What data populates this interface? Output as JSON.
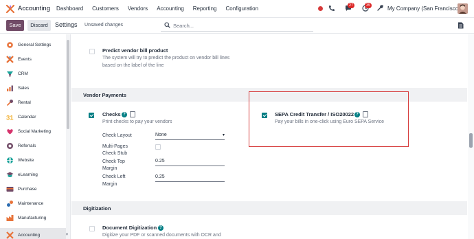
{
  "navbar": {
    "app_name": "Accounting",
    "menu": [
      "Dashboard",
      "Customers",
      "Vendors",
      "Accounting",
      "Reporting",
      "Configuration"
    ],
    "chat_badge": "27",
    "activity_badge": "35",
    "company": "My Company (San Francisco)"
  },
  "control": {
    "save_label": "Save",
    "discard_label": "Discard",
    "breadcrumb": "Settings",
    "status": "Unsaved changes",
    "search_placeholder": "Search..."
  },
  "sidebar": {
    "items": [
      {
        "label": "General Settings",
        "color": "#e8743b"
      },
      {
        "label": "Events",
        "color": "#e8743b"
      },
      {
        "label": "CRM",
        "color": "#1aa39a"
      },
      {
        "label": "Sales",
        "color": "#e8743b"
      },
      {
        "label": "Rental",
        "color": "#714b67"
      },
      {
        "label": "Calendar",
        "color": "#f2b134"
      },
      {
        "label": "Social Marketing",
        "color": "#d6336c"
      },
      {
        "label": "Referrals",
        "color": "#714b67"
      },
      {
        "label": "Website",
        "color": "#1aa39a"
      },
      {
        "label": "eLearning",
        "color": "#714b67"
      },
      {
        "label": "Purchase",
        "color": "#714b67"
      },
      {
        "label": "Maintenance",
        "color": "#2b6cb0"
      },
      {
        "label": "Manufacturing",
        "color": "#e8743b"
      },
      {
        "label": "Accounting",
        "color": "#e8743b"
      }
    ]
  },
  "settings": {
    "predict": {
      "title": "Predict vendor bill product",
      "desc_line1": "The system will try to predict the product on vendor bill lines",
      "desc_line2": "based on the label of the line"
    },
    "vendor_payments": {
      "heading": "Vendor Payments",
      "checks": {
        "title": "Checks",
        "desc": "Print checks to pay your vendors",
        "check_layout_label": "Check Layout",
        "check_layout_value": "None",
        "multi_pages_label_1": "Multi-Pages",
        "multi_pages_label_2": "Check Stub",
        "check_top_label_1": "Check Top",
        "check_top_label_2": "Margin",
        "check_top_value": "0.25",
        "check_left_label_1": "Check Left",
        "check_left_label_2": "Margin",
        "check_left_value": "0.25"
      },
      "sepa": {
        "title": "SEPA Credit Transfer / ISO20022",
        "desc": "Pay your bills in one-click using Euro SEPA Service"
      }
    },
    "digitization": {
      "heading": "Digitization",
      "doc_title": "Document Digitization",
      "doc_desc": "Digitize your PDF or scanned documents with OCR and"
    }
  },
  "colors": {
    "brand": "#714b67",
    "checkbox": "#017e84",
    "highlight": "#d63a3a"
  }
}
